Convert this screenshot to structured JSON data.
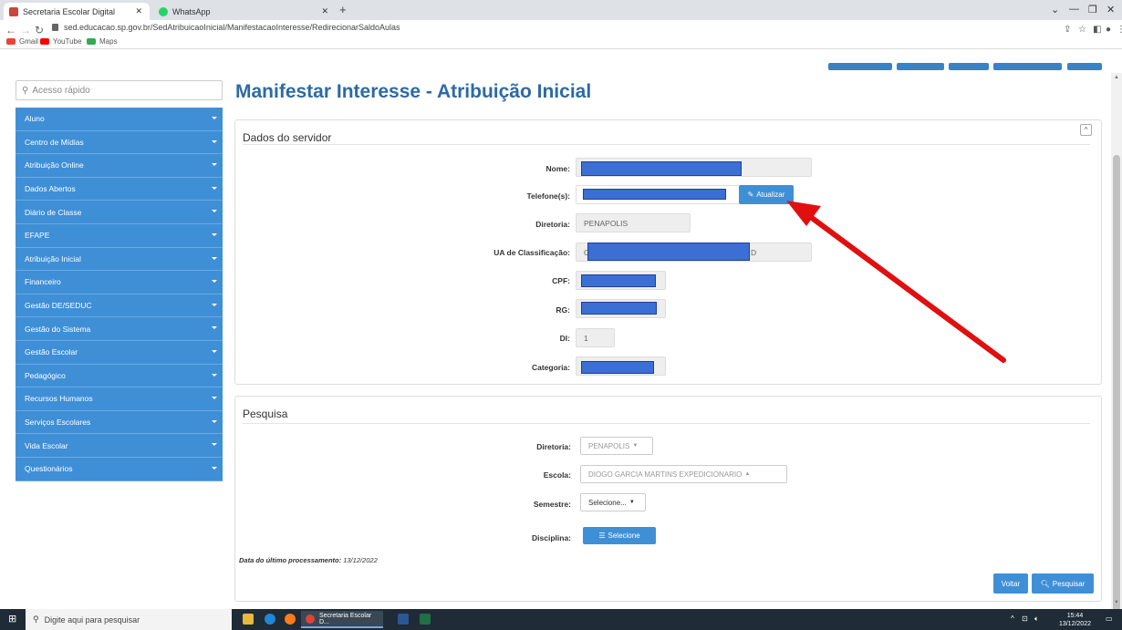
{
  "browser": {
    "tabs": [
      {
        "label": "Secretaria Escolar Digital"
      },
      {
        "label": "WhatsApp"
      }
    ],
    "url": "sed.educacao.sp.gov.br/SedAtribuicaoInicial/ManifestacaoInteresse/RedirecionarSaldoAulas",
    "bookmarks": [
      {
        "label": "Gmail"
      },
      {
        "label": "YouTube"
      },
      {
        "label": "Maps"
      }
    ]
  },
  "sidebar": {
    "search_placeholder": "Acesso rápido",
    "items": [
      {
        "label": "Aluno"
      },
      {
        "label": "Centro de Mídias"
      },
      {
        "label": "Atribuição Online"
      },
      {
        "label": "Dados Abertos"
      },
      {
        "label": "Diário de Classe"
      },
      {
        "label": "EFAPE"
      },
      {
        "label": "Atribuição Inicial"
      },
      {
        "label": "Financeiro"
      },
      {
        "label": "Gestão DE/SEDUC"
      },
      {
        "label": "Gestão do Sistema"
      },
      {
        "label": "Gestão Escolar"
      },
      {
        "label": "Pedagógico"
      },
      {
        "label": "Recursos Humanos"
      },
      {
        "label": "Serviços Escolares"
      },
      {
        "label": "Vida Escolar"
      },
      {
        "label": "Questionários"
      }
    ]
  },
  "page": {
    "title": "Manifestar Interesse - Atribuição Inicial"
  },
  "servidor": {
    "title": "Dados do servidor",
    "collapse_icon": "^",
    "nome_label": "Nome:",
    "telefone_label": "Telefone(s):",
    "atualizar_label": "Atualizar",
    "diretoria_label": "Diretoria:",
    "diretoria_value": "PENAPOLIS",
    "ua_label": "UA de Classificação:",
    "ua_prefix": "C",
    "ua_suffix": "D",
    "cpf_label": "CPF:",
    "rg_label": "RG:",
    "di_label": "DI:",
    "di_value": "1",
    "categoria_label": "Categoria:"
  },
  "pesquisa": {
    "title": "Pesquisa",
    "diretoria_label": "Diretoria:",
    "diretoria_value": "PENAPOLIS",
    "escola_label": "Escola:",
    "escola_value": "DIOGO GARCIA MARTINS EXPEDICIONARIO",
    "semestre_label": "Semestre:",
    "semestre_value": "Selecione...",
    "disciplina_label": "Disciplina:",
    "disciplina_button": "Selecione",
    "last_processing_label": "Data do último processamento:",
    "last_processing_value": "13/12/2022",
    "voltar_label": "Voltar",
    "pesquisar_label": "Pesquisar"
  },
  "taskbar": {
    "search_placeholder": "Digite aqui para pesquisar",
    "active_app": "Secretaria Escolar D...",
    "time": "15:44",
    "date": "13/12/2022"
  },
  "colors": {
    "accent": "#3f8fd6",
    "title": "#2c6aa6",
    "redaction": "#3b6fd4",
    "arrow": "#e01010"
  }
}
